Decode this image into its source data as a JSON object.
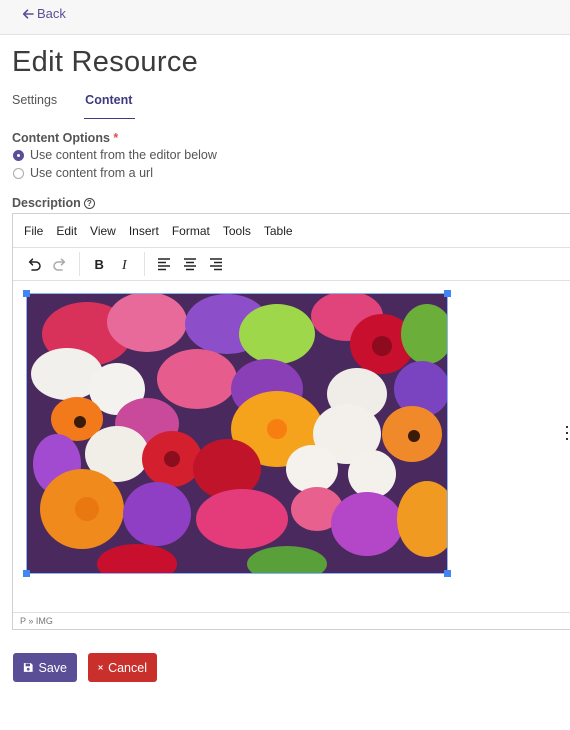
{
  "nav": {
    "back_label": "Back"
  },
  "page": {
    "title": "Edit Resource"
  },
  "tabs": [
    {
      "label": "Settings",
      "active": false
    },
    {
      "label": "Content",
      "active": true
    }
  ],
  "content_options": {
    "label": "Content Options",
    "required_mark": "*",
    "options": [
      {
        "label": "Use content from the editor below",
        "checked": true
      },
      {
        "label": "Use content from a url",
        "checked": false
      }
    ]
  },
  "description": {
    "label": "Description",
    "help_icon": "question-circle-icon"
  },
  "editor": {
    "menu": [
      "File",
      "Edit",
      "View",
      "Insert",
      "Format",
      "Tools",
      "Table"
    ],
    "toolbar_icons": [
      "undo-icon",
      "redo-icon",
      "bold-icon",
      "italic-icon",
      "align-left-icon",
      "align-center-icon",
      "align-right-icon"
    ],
    "image_subject": "flowers-image",
    "status_path": "P » IMG"
  },
  "actions": {
    "save_label": "Save",
    "cancel_label": "Cancel"
  },
  "colors": {
    "primary": "#5a4f96",
    "danger": "#c9302c",
    "selection": "#4285f4"
  }
}
